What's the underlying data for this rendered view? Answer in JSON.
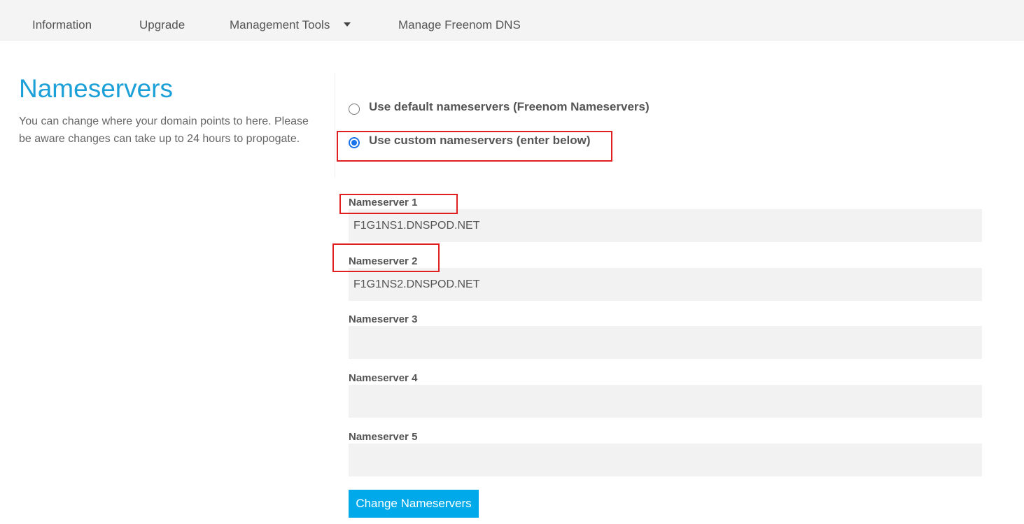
{
  "nav": {
    "items": [
      {
        "label": "Information"
      },
      {
        "label": "Upgrade"
      },
      {
        "label": "Management Tools"
      },
      {
        "label": "Manage Freenom DNS"
      }
    ]
  },
  "main": {
    "title": "Nameservers",
    "description": "You can change where your domain points to here. Please be aware changes can take up to 24 hours to propogate."
  },
  "options": {
    "default_label": "Use default nameservers (Freenom Nameservers)",
    "custom_label": "Use custom nameservers (enter below)",
    "selected": "custom"
  },
  "nameservers": [
    {
      "label": "Nameserver 1",
      "value": "F1G1NS1.DNSPOD.NET"
    },
    {
      "label": "Nameserver 2",
      "value": "F1G1NS2.DNSPOD.NET"
    },
    {
      "label": "Nameserver 3",
      "value": ""
    },
    {
      "label": "Nameserver 4",
      "value": ""
    },
    {
      "label": "Nameserver 5",
      "value": ""
    }
  ],
  "submit_label": "Change Nameservers",
  "colors": {
    "accent": "#1ba0d8",
    "button": "#00a9e9",
    "highlight": "#e02020",
    "input_bg": "#f2f2f2"
  }
}
